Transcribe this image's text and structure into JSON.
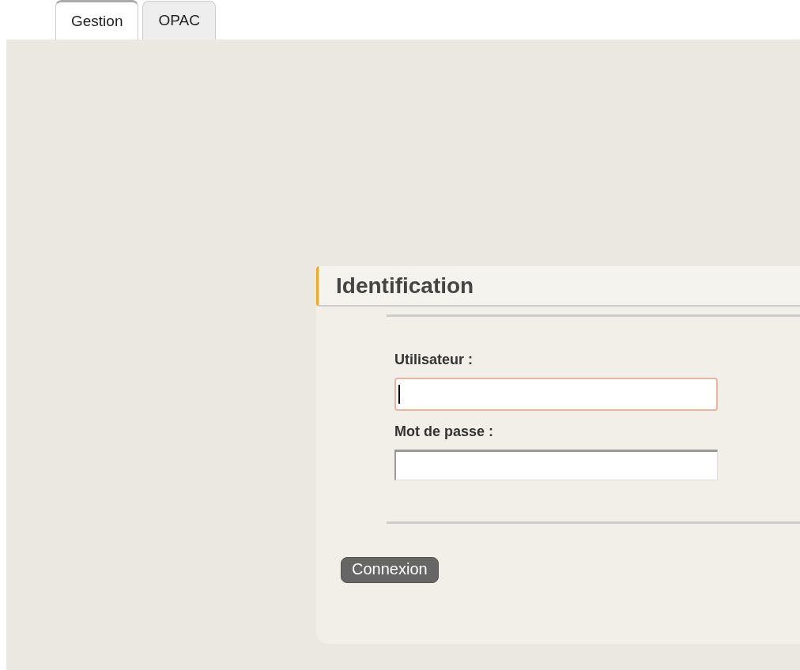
{
  "tabs": [
    {
      "label": "Gestion",
      "selected": true
    },
    {
      "label": "OPAC",
      "selected": false
    }
  ],
  "login": {
    "title": "Identification",
    "fields": [
      {
        "label": "Utilisateur :",
        "focused": true
      },
      {
        "label": "Mot de passe :",
        "focused": false
      }
    ],
    "button": "Connexion"
  }
}
